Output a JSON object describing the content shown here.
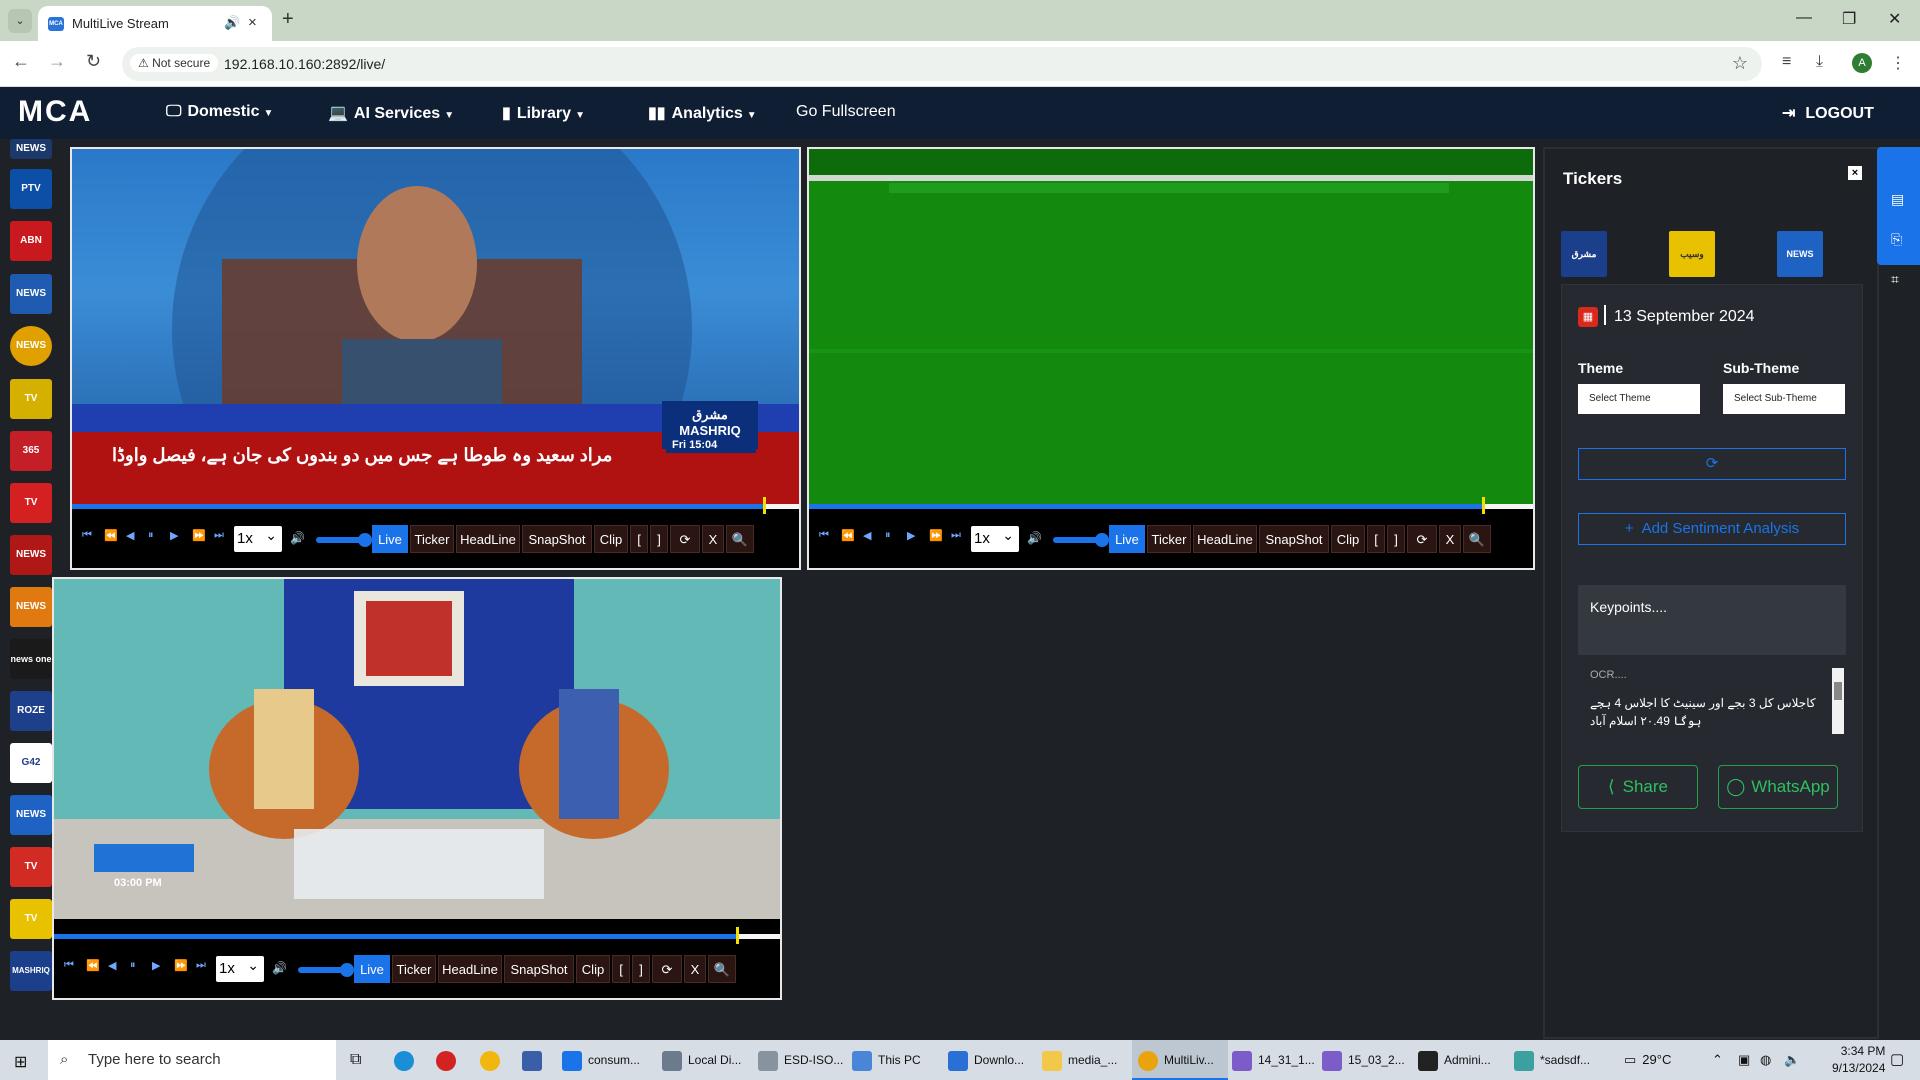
{
  "browser": {
    "tab_title": "MultiLive Stream",
    "tab_favicon": "MCA",
    "new_tab": "+",
    "not_secure": "Not secure",
    "url": "192.168.10.160:2892/live/",
    "profile_initial": "A"
  },
  "app": {
    "brand": "MCA",
    "nav": [
      "Domestic",
      "AI Services",
      "Library",
      "Analytics",
      "Go Fullscreen"
    ],
    "logout": "LOGOUT"
  },
  "channels": [
    {
      "label": "NEWS",
      "color": "#1b3a6b"
    },
    {
      "label": "PTV world",
      "color": "#0b4fa6"
    },
    {
      "label": "ABN NEWS",
      "color": "#c8191f"
    },
    {
      "label": "NEWS",
      "color": "#1f5bb0"
    },
    {
      "label": "NEWS",
      "color": "#e0a000"
    },
    {
      "label": "TV",
      "color": "#d4b000"
    },
    {
      "label": "365",
      "color": "#c41e26"
    },
    {
      "label": "TV",
      "color": "#d42020"
    },
    {
      "label": "NEWS",
      "color": "#b01818"
    },
    {
      "label": "NEWS",
      "color": "#e07a10"
    },
    {
      "label": "news one",
      "color": "#1a1a1a"
    },
    {
      "label": "ROZE",
      "color": "#1e3f8a"
    },
    {
      "label": "G42",
      "color": "#ffffff"
    },
    {
      "label": "NEWS",
      "color": "#1e63c4"
    },
    {
      "label": "TV",
      "color": "#d22b24"
    },
    {
      "label": "TV",
      "color": "#e8c100"
    },
    {
      "label": "MASHRIQ",
      "color": "#1b3f8a"
    }
  ],
  "players": [
    {
      "speed": "1x",
      "buttons": [
        "Live",
        "Ticker",
        "HeadLine",
        "SnapShot",
        "Clip",
        "[",
        "]",
        "⟳",
        "X",
        "🔍"
      ],
      "progress": 0.95,
      "overlay_ticker": "مراد سعید وہ طوطا ہے جس میں دو بندوں کی جان ہے، فیصل واوڈا",
      "overlay_logo": "مشرق MASHRIQ",
      "overlay_time": "Fri 15:04"
    },
    {
      "speed": "1x",
      "buttons": [
        "Live",
        "Ticker",
        "HeadLine",
        "SnapShot",
        "Clip",
        "[",
        "]",
        "⟳",
        "X",
        "🔍"
      ],
      "progress": 0.93
    },
    {
      "speed": "1x",
      "buttons": [
        "Live",
        "Ticker",
        "HeadLine",
        "SnapShot",
        "Clip",
        "[",
        "]",
        "⟳",
        "X",
        "🔍"
      ],
      "progress": 0.94,
      "overlay_time": "03:00 PM"
    }
  ],
  "tickers": {
    "title": "Tickers",
    "close": "×",
    "logos": [
      {
        "label": "مشرق MASHRIQ",
        "color": "#1b3f8a"
      },
      {
        "label": "وسیب",
        "color": "#e8c100"
      },
      {
        "label": "NEWS",
        "color": "#1e63c4"
      }
    ],
    "date": "13 September 2024",
    "theme_label": "Theme",
    "subtheme_label": "Sub-Theme",
    "theme_placeholder": "Select Theme",
    "subtheme_placeholder": "Select Sub-Theme",
    "refresh_icon": "⟳",
    "add_sentiment": "Add Sentiment Analysis",
    "keypoints": "Keypoints....",
    "ocr_label": "OCR....",
    "ocr_text": "کاجلاس کل 3 بجے اور سینیٹ کا اجلاس 4 بجے ہوگا ۲۰.49 اسلام آباد",
    "share": "Share",
    "whatsapp": "WhatsApp"
  },
  "taskbar": {
    "search_placeholder": "Type here to search",
    "items": [
      "consum...",
      "Local Di...",
      "ESD-ISO...",
      "This PC",
      "Downlo...",
      "media_...",
      "MultiLiv...",
      "14_31_1...",
      "15_03_2...",
      "Admini...",
      "*sadsdf..."
    ],
    "temperature": "29°C",
    "time": "3:34 PM",
    "date": "9/13/2024"
  }
}
